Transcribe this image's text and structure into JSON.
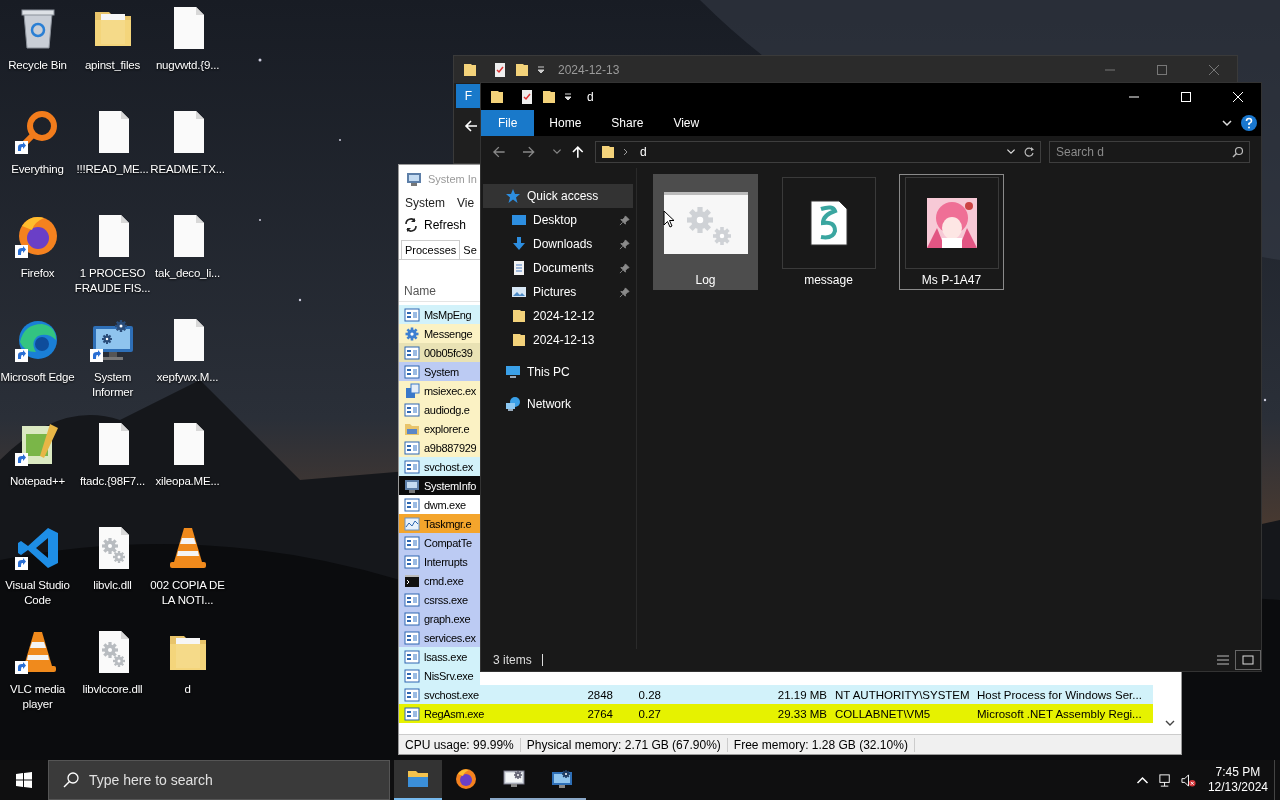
{
  "desktop": {
    "icons": [
      {
        "label": "Recycle Bin",
        "kind": "recycle",
        "shortcut": false
      },
      {
        "label": "apinst_files",
        "kind": "folder",
        "shortcut": false
      },
      {
        "label": "nugvwtd.{9...",
        "kind": "doc",
        "shortcut": false
      },
      {
        "label": "Everything",
        "kind": "everything",
        "shortcut": true
      },
      {
        "label": "!!!READ_ME...",
        "kind": "doc",
        "shortcut": false
      },
      {
        "label": "README.TX...",
        "kind": "doc",
        "shortcut": false
      },
      {
        "label": "Firefox",
        "kind": "firefox",
        "shortcut": true
      },
      {
        "label": "1 PROCESO FRAUDE FIS...",
        "kind": "doc",
        "shortcut": false
      },
      {
        "label": "tak_deco_li...",
        "kind": "doc",
        "shortcut": false
      },
      {
        "label": "Microsoft Edge",
        "kind": "edge",
        "shortcut": true
      },
      {
        "label": "System Informer",
        "kind": "sysinfo",
        "shortcut": true
      },
      {
        "label": "xepfywx.M...",
        "kind": "doc",
        "shortcut": false
      },
      {
        "label": "Notepad++",
        "kind": "notepad",
        "shortcut": true
      },
      {
        "label": "ftadc.{98F7...",
        "kind": "doc",
        "shortcut": false
      },
      {
        "label": "xileopa.ME...",
        "kind": "doc",
        "shortcut": false
      },
      {
        "label": "Visual Studio Code",
        "kind": "vscode",
        "shortcut": true
      },
      {
        "label": "libvlc.dll",
        "kind": "dll",
        "shortcut": false
      },
      {
        "label": "002 COPIA DE LA NOTI...",
        "kind": "vlc",
        "shortcut": false
      },
      {
        "label": "VLC media player",
        "kind": "vlc",
        "shortcut": true
      },
      {
        "label": "libvlccore.dll",
        "kind": "dll",
        "shortcut": false
      },
      {
        "label": "d",
        "kind": "folder",
        "shortcut": false
      }
    ]
  },
  "back_window": {
    "title": "2024-12-13",
    "ribbon_tabs": [
      {
        "label": "F",
        "kind": "menu"
      }
    ]
  },
  "system_informer": {
    "title": "System In",
    "menu": [
      "System",
      "Vie"
    ],
    "toolbar": [
      {
        "label": "Refresh"
      }
    ],
    "tabs": [
      {
        "label": "Processes",
        "selected": true
      },
      {
        "label": "Se",
        "selected": false
      }
    ],
    "columns": [
      "Name"
    ],
    "rows": [
      {
        "name": "MsMpEng",
        "kind": "window",
        "color": "#d2f2fa"
      },
      {
        "name": "Messenge",
        "kind": "gear",
        "color": "#fbf2c4"
      },
      {
        "name": "00b05fc39",
        "kind": "window",
        "color": "#e9e2b4"
      },
      {
        "name": "System",
        "kind": "window",
        "color": "#bccbf3"
      },
      {
        "name": "msiexec.ex",
        "kind": "installer",
        "color": "#fbf2c4"
      },
      {
        "name": "audiodg.e",
        "kind": "window",
        "color": "#fbf2c4"
      },
      {
        "name": "explorer.e",
        "kind": "folder",
        "color": "#fbf2c4"
      },
      {
        "name": "a9b887929",
        "kind": "window",
        "color": "#fbf2c4"
      },
      {
        "name": "svchost.ex",
        "kind": "window",
        "color": "#d2f2fa"
      },
      {
        "name": "SystemInfo",
        "kind": "monitor",
        "color": "#0c0c0c"
      },
      {
        "name": "dwm.exe",
        "kind": "window",
        "color": "#ffffff"
      },
      {
        "name": "Taskmgr.e",
        "kind": "chart",
        "color": "#f4a52c"
      },
      {
        "name": "CompatTe",
        "kind": "window",
        "color": "#bccbf3"
      },
      {
        "name": "Interrupts",
        "kind": "window",
        "color": "#bccbf3"
      },
      {
        "name": "cmd.exe",
        "kind": "console",
        "color": "#bccbf3"
      },
      {
        "name": "csrss.exe",
        "kind": "window",
        "color": "#bccbf3"
      },
      {
        "name": "graph.exe",
        "kind": "window",
        "color": "#bccbf3"
      },
      {
        "name": "services.ex",
        "kind": "window",
        "color": "#bccbf3"
      },
      {
        "name": "lsass.exe",
        "kind": "window",
        "color": "#d2f2fa"
      },
      {
        "name": "NisSrv.exe",
        "kind": "window",
        "color": "#d2f2fa"
      },
      {
        "name": "svchost.exe",
        "kind": "window",
        "color": "#d2f2fa",
        "pid": "2848",
        "cpu": "0.28",
        "memory": "21.19 MB",
        "user": "NT AUTHORITY\\SYSTEM",
        "description": "Host Process for Windows Ser..."
      },
      {
        "name": "RegAsm.exe",
        "kind": "window",
        "color": "#e6f200",
        "pid": "2764",
        "cpu": "0.27",
        "memory": "29.33 MB",
        "user": "COLLABNET\\VM5",
        "description": "Microsoft .NET Assembly Regi..."
      }
    ],
    "status": [
      "CPU usage: 99.99%",
      "Physical memory: 2.71 GB (67.90%)",
      "Free memory: 1.28 GB (32.10%)"
    ]
  },
  "explorer": {
    "title": "d",
    "ribbon_tabs": [
      {
        "label": "File",
        "kind": "menu"
      },
      {
        "label": "Home",
        "kind": "tab"
      },
      {
        "label": "Share",
        "kind": "tab"
      },
      {
        "label": "View",
        "kind": "tab"
      }
    ],
    "address": {
      "path": [
        "d"
      ]
    },
    "search": {
      "placeholder": "Search d"
    },
    "navigation": [
      {
        "label": "Quick access",
        "kind": "star",
        "selected": true,
        "children": [
          {
            "label": "Desktop",
            "kind": "desktop",
            "pinned": true,
            "selected": false
          },
          {
            "label": "Downloads",
            "kind": "downloads",
            "pinned": true,
            "selected": false
          },
          {
            "label": "Documents",
            "kind": "documents",
            "pinned": true,
            "selected": false
          },
          {
            "label": "Pictures",
            "kind": "pictures",
            "pinned": true,
            "selected": false
          },
          {
            "label": "2024-12-12",
            "kind": "folder",
            "pinned": false,
            "selected": false
          },
          {
            "label": "2024-12-13",
            "kind": "folder",
            "pinned": false,
            "selected": false
          }
        ]
      },
      {
        "label": "This PC",
        "kind": "pc",
        "selected": false
      },
      {
        "label": "Network",
        "kind": "network",
        "selected": false
      }
    ],
    "files": [
      {
        "name": "Log",
        "kind": "settings",
        "selected": true,
        "focused": false
      },
      {
        "name": "message",
        "kind": "script",
        "selected": false,
        "focused": false
      },
      {
        "name": "Ms P-1A47",
        "kind": "picture",
        "selected": false,
        "focused": true
      }
    ],
    "status": "3 items"
  },
  "taskbar": {
    "search": {
      "placeholder": "Type here to search"
    },
    "apps": [
      {
        "kind": "explorer",
        "active": true,
        "running": true
      },
      {
        "kind": "firefox",
        "active": false,
        "running": false
      },
      {
        "kind": "sysinfo",
        "active": false,
        "running": true
      },
      {
        "kind": "monitor",
        "active": false,
        "running": true
      }
    ],
    "time": "7:45 PM",
    "date": "12/13/2024"
  }
}
